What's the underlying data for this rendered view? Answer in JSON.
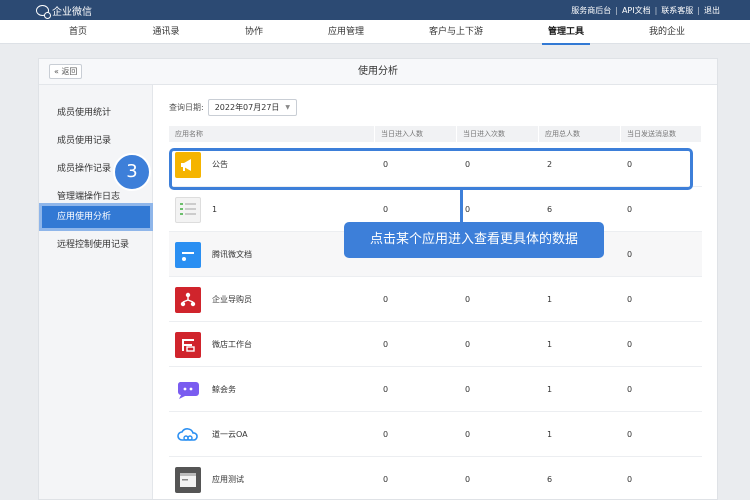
{
  "topbar": {
    "brand": "企业微信",
    "links": [
      "服务商后台",
      "API文档",
      "联系客服",
      "退出"
    ]
  },
  "nav": {
    "items": [
      {
        "label": "首页",
        "active": false
      },
      {
        "label": "通讯录",
        "active": false
      },
      {
        "label": "协作",
        "active": false
      },
      {
        "label": "应用管理",
        "active": false
      },
      {
        "label": "客户与上下游",
        "active": false
      },
      {
        "label": "管理工具",
        "active": true
      },
      {
        "label": "我的企业",
        "active": false
      }
    ]
  },
  "panel": {
    "back_label": "« 返回",
    "title": "使用分析"
  },
  "sidebar": {
    "items": [
      {
        "label": "成员使用统计",
        "active": false
      },
      {
        "label": "成员使用记录",
        "active": false
      },
      {
        "label": "成员操作记录",
        "active": false
      },
      {
        "label": "管理端操作日志",
        "active": false
      },
      {
        "label": "应用使用分析",
        "active": true
      },
      {
        "label": "远程控制使用记录",
        "active": false
      }
    ]
  },
  "filter": {
    "label": "查询日期:",
    "value": "2022年07月27日"
  },
  "table": {
    "columns": [
      "应用名称",
      "当日进入人数",
      "当日进入次数",
      "应用总人数",
      "当日发送消息数"
    ],
    "rows": [
      {
        "icon": "megaphone-icon",
        "icon_color": "#f5b400",
        "name": "公告",
        "entered_users": "0",
        "entered_times": "0",
        "total_users": "2",
        "messages": "0"
      },
      {
        "icon": "list-thumbnail-icon",
        "icon_color": "#e8e8e8",
        "name": "1",
        "entered_users": "0",
        "entered_times": "0",
        "total_users": "6",
        "messages": "0"
      },
      {
        "icon": "document-icon",
        "icon_color": "#2a8ff2",
        "name": "腾讯微文档",
        "entered_users": "",
        "entered_times": "",
        "total_users": "",
        "messages": "0"
      },
      {
        "icon": "org-chart-icon",
        "icon_color": "#d0242c",
        "name": "企业导购员",
        "entered_users": "0",
        "entered_times": "0",
        "total_users": "1",
        "messages": "0"
      },
      {
        "icon": "store-icon",
        "icon_color": "#d0242c",
        "name": "微店工作台",
        "entered_users": "0",
        "entered_times": "0",
        "total_users": "1",
        "messages": "0"
      },
      {
        "icon": "chat-bubble-icon",
        "icon_color": "#7a5cf0",
        "name": "鲸会务",
        "entered_users": "0",
        "entered_times": "0",
        "total_users": "1",
        "messages": "0"
      },
      {
        "icon": "cloud-link-icon",
        "icon_color": "#ffffff",
        "name": "道一云OA",
        "entered_users": "0",
        "entered_times": "0",
        "total_users": "1",
        "messages": "0"
      },
      {
        "icon": "window-icon",
        "icon_color": "#555555",
        "name": "应用测试",
        "entered_users": "0",
        "entered_times": "0",
        "total_users": "6",
        "messages": "0"
      }
    ]
  },
  "annotation": {
    "step": "3",
    "callout": "点击某个应用进入查看更具体的数据",
    "accent": "#3d7fd9"
  }
}
